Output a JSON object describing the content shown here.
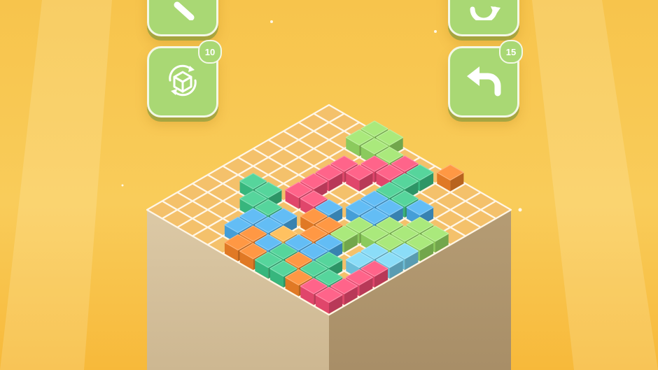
{
  "buttons": {
    "rotate_view": {
      "badge": "10",
      "icon": "rotate-cube-icon"
    },
    "undo": {
      "badge": "15",
      "icon": "undo-arrow-icon"
    },
    "top_left": {
      "icon": "partial-icon"
    },
    "top_right": {
      "icon": "refresh-icon"
    }
  },
  "board": {
    "size": 12,
    "empty_cell_color": "#f4c16b",
    "grid_line_color": "#fff6e6"
  },
  "palette": {
    "G": "#9ee66a",
    "T": "#3fcf8e",
    "P": "#ff4f7a",
    "B": "#4eb4f4",
    "L": "#7bd8f7",
    "O": "#ff8a2a",
    "Y": "#ffb94a"
  },
  "pieces": [
    {
      "color": "G",
      "cells": [
        [
          0,
          3
        ],
        [
          0,
          4
        ],
        [
          1,
          3
        ],
        [
          1,
          4
        ],
        [
          1,
          5
        ]
      ]
    },
    {
      "color": "O",
      "cells": [
        [
          0,
          8
        ]
      ]
    },
    {
      "color": "P",
      "cells": [
        [
          1,
          6
        ],
        [
          2,
          5
        ],
        [
          2,
          6
        ],
        [
          3,
          4
        ],
        [
          3,
          5
        ],
        [
          4,
          4
        ]
      ]
    },
    {
      "color": "T",
      "cells": [
        [
          2,
          7
        ],
        [
          3,
          7
        ],
        [
          3,
          8
        ],
        [
          1,
          7
        ]
      ]
    },
    {
      "color": "B",
      "cells": [
        [
          3,
          9
        ],
        [
          4,
          8
        ],
        [
          4,
          7
        ],
        [
          5,
          7
        ],
        [
          5,
          8
        ]
      ]
    },
    {
      "color": "G",
      "cells": [
        [
          4,
          10
        ],
        [
          4,
          11
        ],
        [
          5,
          10
        ],
        [
          5,
          9
        ],
        [
          6,
          9
        ],
        [
          6,
          8
        ],
        [
          7,
          8
        ],
        [
          5,
          11
        ],
        [
          6,
          10
        ]
      ]
    },
    {
      "color": "L",
      "cells": [
        [
          6,
          11
        ],
        [
          7,
          11
        ],
        [
          7,
          10
        ],
        [
          8,
          10
        ]
      ]
    },
    {
      "color": "P",
      "cells": [
        [
          8,
          11
        ],
        [
          9,
          11
        ],
        [
          10,
          11
        ],
        [
          11,
          11
        ],
        [
          11,
          10
        ]
      ]
    },
    {
      "color": "P",
      "cells": [
        [
          5,
          4
        ],
        [
          6,
          4
        ],
        [
          6,
          5
        ]
      ]
    },
    {
      "color": "O",
      "cells": [
        [
          7,
          6
        ],
        [
          7,
          7
        ],
        [
          8,
          7
        ]
      ]
    },
    {
      "color": "B",
      "cells": [
        [
          6,
          6
        ],
        [
          8,
          8
        ],
        [
          9,
          8
        ]
      ]
    },
    {
      "color": "T",
      "cells": [
        [
          9,
          9
        ],
        [
          10,
          9
        ],
        [
          10,
          10
        ]
      ]
    },
    {
      "color": "T",
      "cells": [
        [
          7,
          2
        ],
        [
          7,
          3
        ],
        [
          8,
          3
        ],
        [
          8,
          4
        ]
      ]
    },
    {
      "color": "B",
      "cells": [
        [
          8,
          5
        ],
        [
          9,
          5
        ],
        [
          9,
          4
        ],
        [
          10,
          4
        ]
      ]
    },
    {
      "color": "Y",
      "cells": [
        [
          9,
          6
        ]
      ]
    },
    {
      "color": "B",
      "cells": [
        [
          10,
          6
        ],
        [
          9,
          7
        ]
      ]
    },
    {
      "color": "O",
      "cells": [
        [
          10,
          5
        ],
        [
          11,
          5
        ],
        [
          11,
          6
        ]
      ]
    },
    {
      "color": "T",
      "cells": [
        [
          10,
          7
        ],
        [
          11,
          7
        ],
        [
          11,
          8
        ]
      ]
    },
    {
      "color": "O",
      "cells": [
        [
          10,
          8
        ],
        [
          12,
          8
        ]
      ]
    },
    {
      "color": "T",
      "cells": [
        [
          13,
          9
        ],
        [
          12,
          9
        ],
        [
          13,
          10
        ]
      ]
    },
    {
      "color": "O",
      "cells": [
        [
          11,
          9
        ]
      ]
    },
    {
      "color": "O",
      "cells": [
        [
          13,
          11
        ]
      ]
    }
  ]
}
